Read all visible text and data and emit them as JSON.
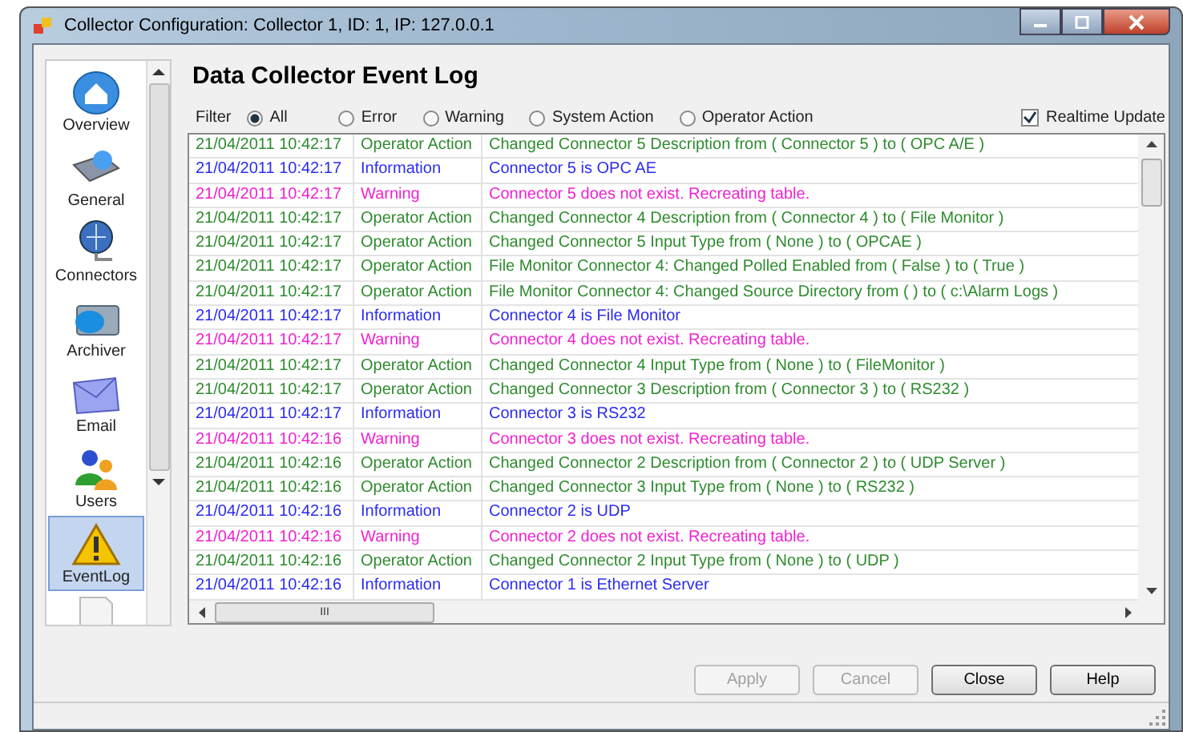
{
  "window": {
    "title": "Collector Configuration: Collector 1, ID: 1, IP: 127.0.0.1"
  },
  "sidebar": {
    "items": [
      {
        "label": "Overview",
        "kind": "overview",
        "selected": false
      },
      {
        "label": "General",
        "kind": "general",
        "selected": false
      },
      {
        "label": "Connectors",
        "kind": "connectors",
        "selected": false
      },
      {
        "label": "Archiver",
        "kind": "archiver",
        "selected": false
      },
      {
        "label": "Email",
        "kind": "email",
        "selected": false
      },
      {
        "label": "Users",
        "kind": "users",
        "selected": false
      },
      {
        "label": "EventLog",
        "kind": "eventlog",
        "selected": true
      },
      {
        "kind": "document",
        "selected": false
      }
    ]
  },
  "heading": "Data Collector Event Log",
  "filter": {
    "label": "Filter",
    "options": [
      {
        "label": "All",
        "selected": true
      },
      {
        "label": "Error",
        "selected": false
      },
      {
        "label": "Warning",
        "selected": false
      },
      {
        "label": "System Action",
        "selected": false
      },
      {
        "label": "Operator Action",
        "selected": false
      }
    ]
  },
  "realtime_update": {
    "label": "Realtime Update",
    "checked": true
  },
  "table": {
    "rows": [
      {
        "time": "21/04/2011 10:42:17",
        "type": "Operator Action",
        "message": "Changed Connector 5 Description from ( Connector 5 ) to ( OPC A/E )",
        "color": "#2e8b2e"
      },
      {
        "time": "21/04/2011 10:42:17",
        "type": "Information",
        "message": "Connector 5 is OPC AE",
        "color": "#2b2bf0"
      },
      {
        "time": "21/04/2011 10:42:17",
        "type": "Warning",
        "message": "Connector 5 does not exist. Recreating table.",
        "color": "#f020d0"
      },
      {
        "time": "21/04/2011 10:42:17",
        "type": "Operator Action",
        "message": "Changed Connector 4 Description from ( Connector 4 ) to ( File Monitor )",
        "color": "#2e8b2e"
      },
      {
        "time": "21/04/2011 10:42:17",
        "type": "Operator Action",
        "message": "Changed Connector 5 Input Type from ( None ) to ( OPCAE )",
        "color": "#2e8b2e"
      },
      {
        "time": "21/04/2011 10:42:17",
        "type": "Operator Action",
        "message": "File Monitor Connector 4: Changed Polled Enabled from ( False ) to ( True )",
        "color": "#2e8b2e"
      },
      {
        "time": "21/04/2011 10:42:17",
        "type": "Operator Action",
        "message": "File Monitor Connector 4: Changed Source Directory from (  ) to ( c:\\Alarm Logs )",
        "color": "#2e8b2e"
      },
      {
        "time": "21/04/2011 10:42:17",
        "type": "Information",
        "message": "Connector 4 is File Monitor",
        "color": "#2b2bf0"
      },
      {
        "time": "21/04/2011 10:42:17",
        "type": "Warning",
        "message": "Connector 4 does not exist. Recreating table.",
        "color": "#f020d0"
      },
      {
        "time": "21/04/2011 10:42:17",
        "type": "Operator Action",
        "message": "Changed Connector 4 Input Type from ( None ) to ( FileMonitor )",
        "color": "#2e8b2e"
      },
      {
        "time": "21/04/2011 10:42:17",
        "type": "Operator Action",
        "message": "Changed Connector 3 Description from ( Connector 3 ) to ( RS232 )",
        "color": "#2e8b2e"
      },
      {
        "time": "21/04/2011 10:42:17",
        "type": "Information",
        "message": "Connector 3 is RS232",
        "color": "#2b2bf0"
      },
      {
        "time": "21/04/2011 10:42:16",
        "type": "Warning",
        "message": "Connector 3 does not exist. Recreating table.",
        "color": "#f020d0"
      },
      {
        "time": "21/04/2011 10:42:16",
        "type": "Operator Action",
        "message": "Changed Connector 2 Description from ( Connector 2 ) to ( UDP Server )",
        "color": "#2e8b2e"
      },
      {
        "time": "21/04/2011 10:42:16",
        "type": "Operator Action",
        "message": "Changed Connector 3 Input Type from ( None ) to ( RS232 )",
        "color": "#2e8b2e"
      },
      {
        "time": "21/04/2011 10:42:16",
        "type": "Information",
        "message": "Connector 2 is UDP",
        "color": "#2b2bf0"
      },
      {
        "time": "21/04/2011 10:42:16",
        "type": "Warning",
        "message": "Connector 2 does not exist. Recreating table.",
        "color": "#f020d0"
      },
      {
        "time": "21/04/2011 10:42:16",
        "type": "Operator Action",
        "message": "Changed Connector 2 Input Type from ( None ) to ( UDP )",
        "color": "#2e8b2e"
      },
      {
        "time": "21/04/2011 10:42:16",
        "type": "Information",
        "message": "Connector 1 is Ethernet Server",
        "color": "#2b2bf0"
      }
    ]
  },
  "hscroll_grip": "III",
  "buttons": [
    {
      "label": "Apply",
      "disabled": true
    },
    {
      "label": "Cancel",
      "disabled": true
    },
    {
      "label": "Close",
      "disabled": false
    },
    {
      "label": "Help",
      "disabled": false
    }
  ]
}
